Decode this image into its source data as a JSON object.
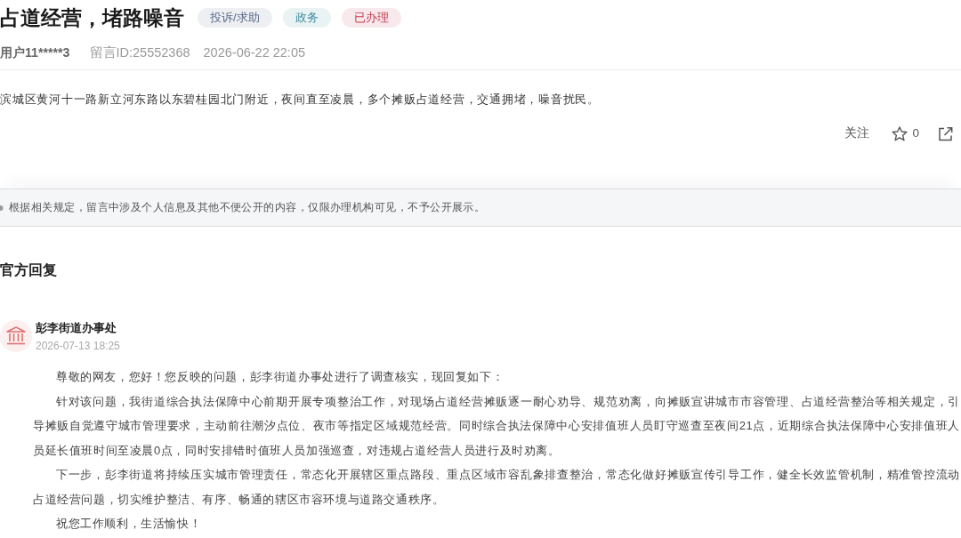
{
  "complaint": {
    "title": "占道经营，堵路噪音",
    "tags": [
      {
        "label": "投诉/求助",
        "color": "#5b6b8c"
      },
      {
        "label": "政务",
        "color": "#3f8e9e"
      },
      {
        "label": "已办理",
        "color": "#c23b50"
      }
    ],
    "user": "用户11*****3",
    "message_id": "留言ID:25552368",
    "posted_at": "2026-06-22 22:05",
    "content": "滨城区黄河十一路新立河东路以东碧桂园北门附近，夜间直至凌晨，多个摊贩占道经营，交通拥堵，噪音扰民。",
    "actions": {
      "follow": "关注",
      "star_count": "0"
    }
  },
  "notice": "根据相关规定，留言中涉及个人信息及其他不便公开的内容，仅限办理机构可见，不予公开展示。",
  "official_reply": {
    "heading": "官方回复",
    "responder": "彭李街道办事处",
    "replied_at": "2026-07-13 18:25",
    "paragraphs": [
      "尊敬的网友，您好！您反映的问题，彭李街道办事处进行了调查核实，现回复如下：",
      "针对该问题，我街道综合执法保障中心前期开展专项整治工作，对现场占道经营摊贩逐一耐心劝导、规范劝离，向摊贩宣讲城市市容管理、占道经营整治等相关规定，引导摊贩自觉遵守城市管理要求，主动前往潮汐点位、夜市等指定区域规范经营。同时综合执法保障中心安排值班人员盯守巡查至夜间21点，近期综合执法保障中心安排值班人员延长值班时间至凌晨0点，同时安排错时值班人员加强巡查，对违规占道经营人员进行及时劝离。",
      "下一步，彭李街道将持续压实城市管理责任，常态化开展辖区重点路段、重点区域市容乱象排查整治，常态化做好摊贩宣传引导工作，健全长效监管机制，精准管控流动占道经营问题，切实维护整洁、有序、畅通的辖区市容环境与道路交通秩序。",
      "祝您工作顺利，生活愉快！"
    ]
  }
}
